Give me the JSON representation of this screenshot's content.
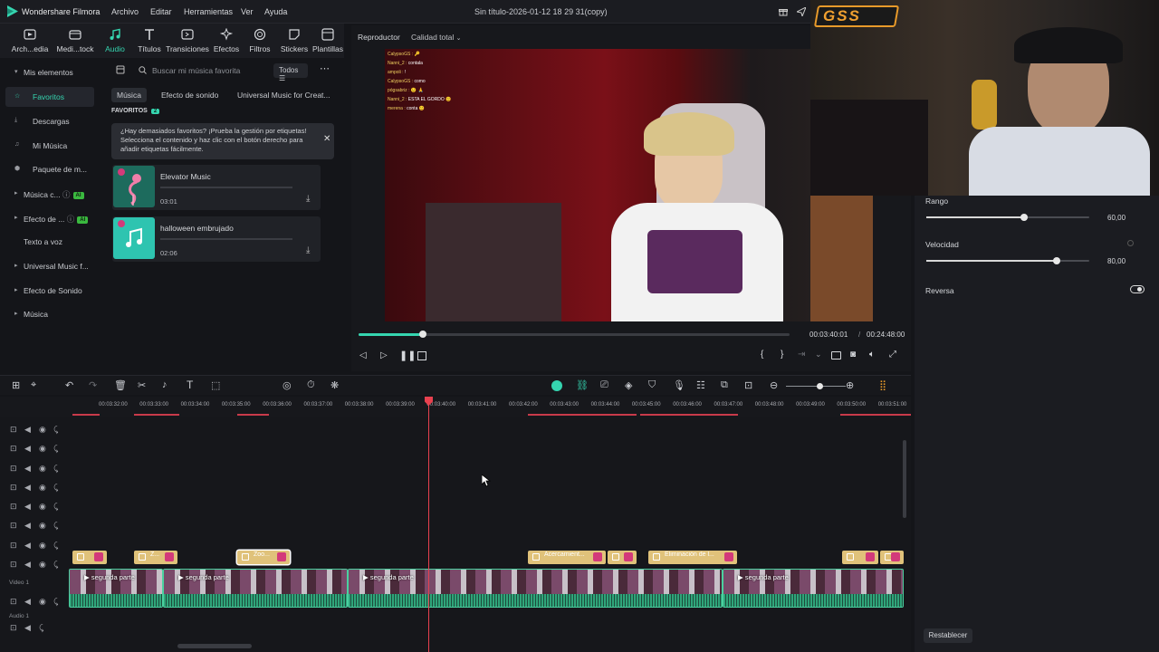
{
  "app": {
    "name": "Wondershare Filmora",
    "menu": [
      "Archivo",
      "Editar",
      "Herramientas",
      "Ver",
      "Ayuda"
    ],
    "document_title": "Sin título-2026-01-12 18 29 31(copy)"
  },
  "tabs": [
    {
      "label": "Arch...edia",
      "icon": "media-icon"
    },
    {
      "label": "Medi...tock",
      "icon": "stock-icon"
    },
    {
      "label": "Audio",
      "icon": "music-note-icon",
      "active": true
    },
    {
      "label": "Títulos",
      "icon": "title-icon"
    },
    {
      "label": "Transiciones",
      "icon": "transition-icon"
    },
    {
      "label": "Efectos",
      "icon": "effects-icon"
    },
    {
      "label": "Filtros",
      "icon": "filter-icon"
    },
    {
      "label": "Stickers",
      "icon": "sticker-icon"
    },
    {
      "label": "Plantillas",
      "icon": "template-icon"
    }
  ],
  "sidebar": {
    "items": [
      {
        "label": "Mis elementos",
        "caret": "▾"
      },
      {
        "label": "Favoritos",
        "selected": true,
        "icon": "star-icon"
      },
      {
        "label": "Descargas",
        "icon": "download-icon"
      },
      {
        "label": "Mi Música",
        "icon": "music-icon"
      },
      {
        "label": "Paquete de m...",
        "icon": "package-icon"
      },
      {
        "label": "Música c...",
        "caret": "▸",
        "ai": "AI"
      },
      {
        "label": "Efecto de ...",
        "caret": "▸",
        "ai": "AI"
      },
      {
        "label": "Texto a voz"
      },
      {
        "label": "Universal Music f...",
        "caret": "▸"
      },
      {
        "label": "Efecto de Sonido",
        "caret": "▸"
      },
      {
        "label": "Música",
        "caret": "▸"
      }
    ]
  },
  "music": {
    "search_placeholder": "Buscar mi música favorita",
    "filter": "Todos",
    "categories": [
      "Música",
      "Efecto de sonido",
      "Universal Music for Creat..."
    ],
    "favorites_label": "FAVORITOS",
    "favorites_count": "2",
    "hint": "¿Hay demasiados favoritos? ¡Prueba la gestión por etiquetas! Selecciona el contenido y haz clic con el botón derecho para añadir etiquetas fácilmente.",
    "tracks": [
      {
        "title": "Elevator Music",
        "duration": "03:01"
      },
      {
        "title": "halloween embrujado",
        "duration": "02:06"
      }
    ]
  },
  "player": {
    "label": "Reproductor",
    "quality": "Calidad total",
    "current_time": "00:03:40:01",
    "separator": "/",
    "total_time": "00:24:48:00",
    "progress_fraction": 0.15,
    "chat": [
      {
        "user": "CalypsoGS :",
        "msg": "🔑"
      },
      {
        "user": "Nanni_2 :",
        "msg": "contala"
      },
      {
        "user": "ampoli :",
        "msg": "!"
      },
      {
        "user": "CalypsoGS :",
        "msg": "como"
      },
      {
        "user": "pógsabriz :",
        "msg": "😟 🙏"
      },
      {
        "user": "Nanni_2 :",
        "msg": "ESTA EL GORDO 😊"
      },
      {
        "user": "merena :",
        "msg": "conta 😊"
      }
    ]
  },
  "properties": {
    "range_label": "Rango",
    "range_value": "60,00",
    "range_fraction": 0.6,
    "speed_label": "Velocidad",
    "speed_value": "80,00",
    "speed_fraction": 0.8,
    "reverse_label": "Reversa",
    "reset_label": "Restablecer"
  },
  "overlay": {
    "logo_text": "GSS"
  },
  "timeline": {
    "ticks": [
      "00:03:32:00",
      "00:03:33:00",
      "00:03:34:00",
      "00:03:35:00",
      "00:03:36:00",
      "00:03:37:00",
      "00:03:38:00",
      "00:03:39:00",
      "00:03:40:00",
      "00:03:41:00",
      "00:03:42:00",
      "00:03:43:00",
      "00:03:44:00",
      "00:03:45:00",
      "00:03:46:00",
      "00:03:47:00",
      "00:03:48:00",
      "00:03:49:00",
      "00:03:50:00",
      "00:03:51:00"
    ],
    "video_track_label": "Video 1",
    "audio_track_label": "Audio 1",
    "effect_clips": [
      "Z...",
      "Zoo...",
      "Acercamient...",
      "Eliminación de l..."
    ],
    "video_clips": [
      "segunda parte",
      "segunda parte",
      "segunda parte",
      "segunda parte"
    ]
  },
  "colors": {
    "accent": "#35d5b0",
    "playhead": "#e8414f",
    "effect_clip": "#e0c27a"
  }
}
